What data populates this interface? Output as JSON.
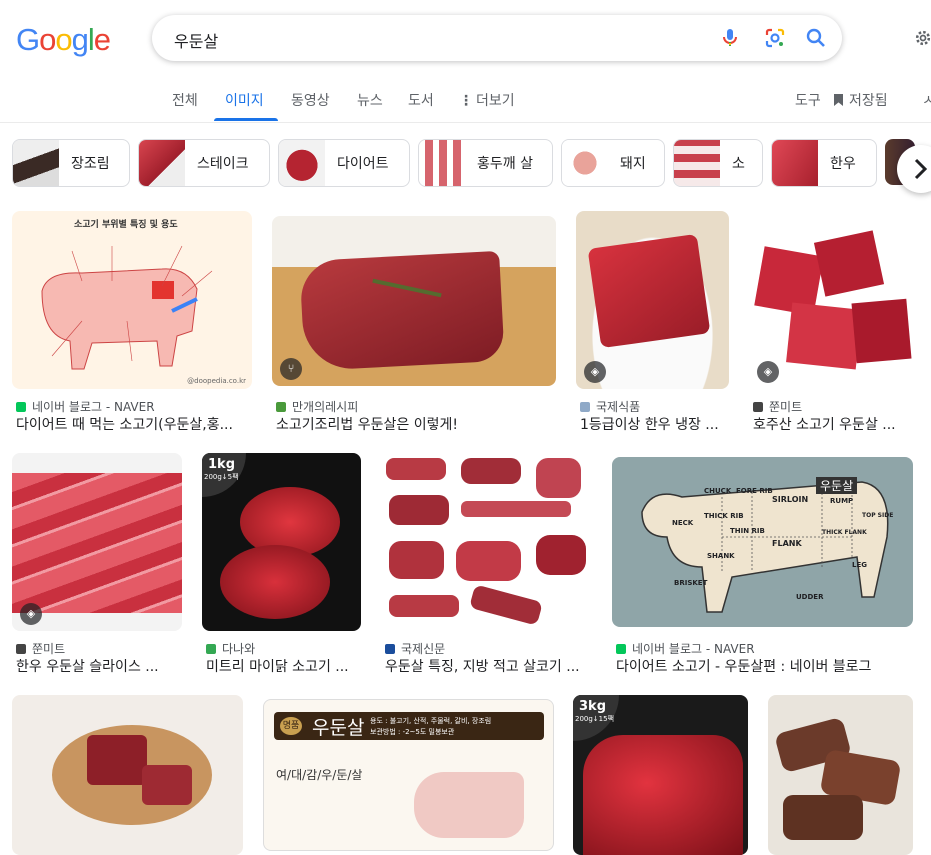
{
  "logo": {
    "letters": [
      "G",
      "o",
      "o",
      "g",
      "l",
      "e"
    ],
    "colors": [
      "#4285F4",
      "#EA4335",
      "#FBBC05",
      "#4285F4",
      "#34A853",
      "#EA4335"
    ]
  },
  "search": {
    "query": "우둔살"
  },
  "tabs": [
    {
      "label": "전체"
    },
    {
      "label": "이미지",
      "active": true
    },
    {
      "label": "동영상"
    },
    {
      "label": "뉴스"
    },
    {
      "label": "도서"
    },
    {
      "label": "더보기"
    }
  ],
  "tools": {
    "tools_label": "도구",
    "saved_label": "저장됨"
  },
  "chips": [
    {
      "label": "장조림"
    },
    {
      "label": "스테이크"
    },
    {
      "label": "다이어트"
    },
    {
      "label": "홍두깨 살"
    },
    {
      "label": "돼지"
    },
    {
      "label": "소"
    },
    {
      "label": "한우"
    }
  ],
  "results": [
    {
      "source": "네이버 블로그 - NAVER",
      "title": "다이어트 때 먹는 소고기(우둔살,홍..."
    },
    {
      "source": "만개의레시피",
      "title": "소고기조리법 우둔살은 이렇게!"
    },
    {
      "source": "국제식품",
      "title": "1등급이상 한우 냉장 ..."
    },
    {
      "source": "쭌미트",
      "title": "호주산 소고기 우둔살 ..."
    },
    {
      "source": "쭌미트",
      "title": "한우 우둔살 슬라이스 ..."
    },
    {
      "source": "다나와",
      "title": "미트리 마이닭 소고기 ..."
    },
    {
      "source": "국제신문",
      "title": "우둔살 특징, 지방 적고 살코기 ..."
    },
    {
      "source": "네이버 블로그 - NAVER",
      "title": "다이어트 소고기 - 우둔살편 : 네이버 블로그"
    }
  ],
  "image_text": {
    "chart_title": "소고기 부위별 특징 및 용도",
    "chart_site": "@doopedia.co.kr",
    "weight_1": "1kg",
    "weight_1_sub": "200g↓5팩",
    "weight_3": "3kg",
    "weight_3_sub": "200g↓15팩",
    "diagram_tag": "우둔살",
    "diagram_labels": [
      "CHUCK",
      "FORE RIB",
      "SIRLOIN",
      "RUMP",
      "TOP SIDE",
      "NECK",
      "THICK RIB",
      "THIN RIB",
      "FLANK",
      "THICK FLANK",
      "SHANK",
      "BRISKET",
      "UDDER",
      "LEG"
    ],
    "poster_badge": "명품",
    "poster_title": "우둔살",
    "poster_usage": "용도 : 불고기, 산적, 주물럭, 갈비, 장조림",
    "poster_storage": "보관방법 : -2~5도 밀봉보관",
    "poster_heading": "여/대/감/우/둔/살"
  },
  "colors": {
    "accent": "#1a73e8",
    "meat": "#c62f3a",
    "meat_dark": "#9e1f2b"
  }
}
